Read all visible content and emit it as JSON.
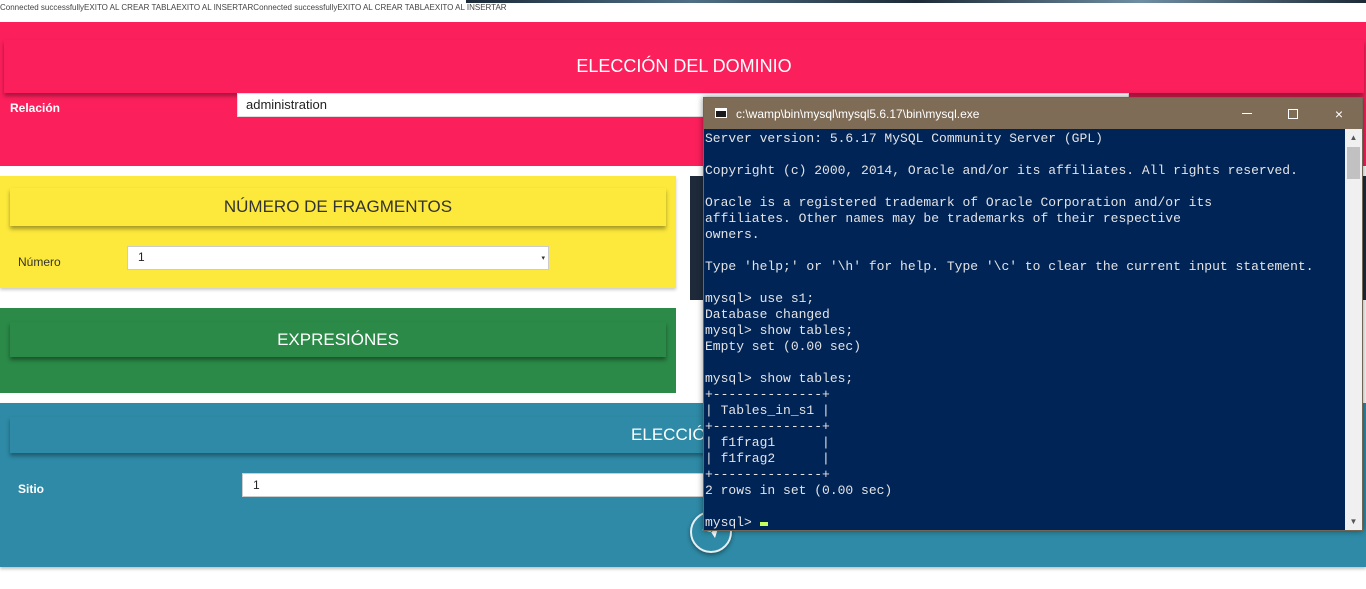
{
  "status_line": "Connected successfullyEXITO AL CREAR TABLAEXITO AL INSERTARConnected successfullyEXITO AL CREAR TABLAEXITO AL INSERTAR",
  "domain_section": {
    "title": "ELECCIÓN DEL DOMINIO",
    "relation_label": "Relación",
    "relation_value": "administration"
  },
  "fragments_section": {
    "title": "NÚMERO DE FRAGMENTOS",
    "number_label": "Número",
    "number_value": "1"
  },
  "expressions_section": {
    "title": "EXPRESIÓNES"
  },
  "site_section": {
    "title": "ELECCIÓN D",
    "site_label": "Sitio",
    "site_value": "1",
    "send_icon": "paper-plane-icon"
  },
  "console": {
    "title": "c:\\wamp\\bin\\mysql\\mysql5.6.17\\bin\\mysql.exe",
    "output": "Server version: 5.6.17 MySQL Community Server (GPL)\n\nCopyright (c) 2000, 2014, Oracle and/or its affiliates. All rights reserved.\n\nOracle is a registered trademark of Oracle Corporation and/or its\naffiliates. Other names may be trademarks of their respective\nowners.\n\nType 'help;' or '\\h' for help. Type '\\c' to clear the current input statement.\n\nmysql> use s1;\nDatabase changed\nmysql> show tables;\nEmpty set (0.00 sec)\n\nmysql> show tables;\n+--------------+\n| Tables_in_s1 |\n+--------------+\n| f1frag1      |\n| f1frag2      |\n+--------------+\n2 rows in set (0.00 sec)\n\n",
    "prompt": "mysql> ",
    "buttons": {
      "minimize": "minimize-icon",
      "maximize": "maximize-icon",
      "close": "×"
    }
  },
  "colors": {
    "pink": "#fb1f5c",
    "yellow": "#fde93b",
    "green": "#2b8a47",
    "blue": "#2e8aa6",
    "console_bg": "#012456",
    "console_titlebar": "#7e6c57"
  }
}
